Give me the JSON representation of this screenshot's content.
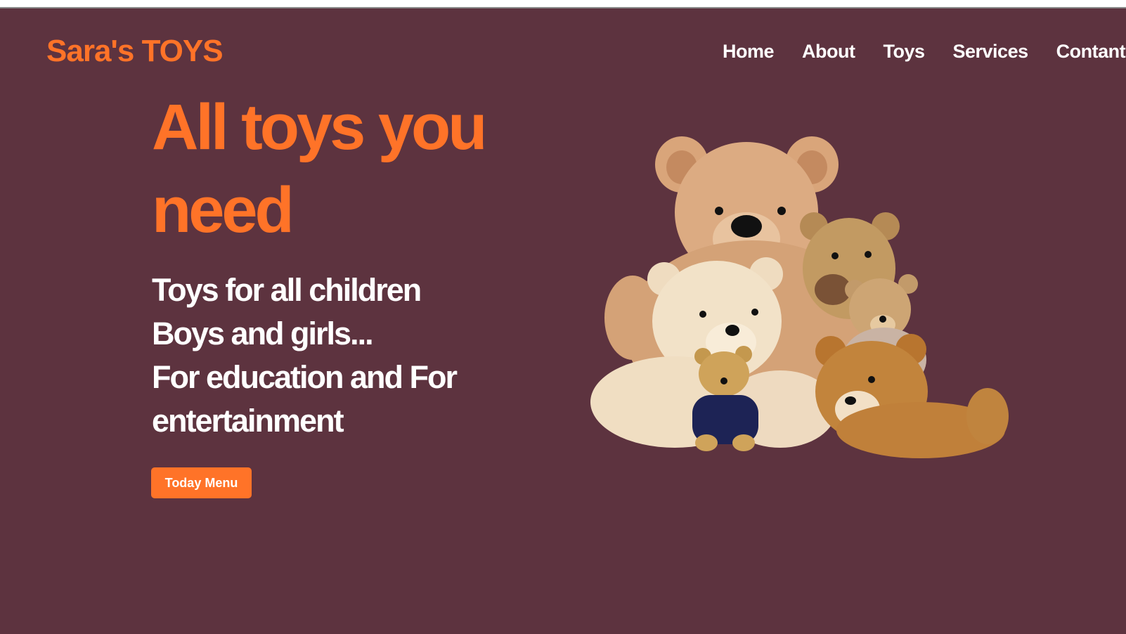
{
  "brand": {
    "name": "Sara's TOYS"
  },
  "nav": [
    {
      "label": "Home"
    },
    {
      "label": "About"
    },
    {
      "label": "Toys"
    },
    {
      "label": "Services"
    },
    {
      "label": "Contant"
    }
  ],
  "hero": {
    "headline": "All toys you need",
    "lines": [
      "Toys for all children",
      "Boys and girls...",
      "For education and For entertainment"
    ],
    "cta_label": "Today Menu",
    "image": "teddy-bears-photo"
  },
  "colors": {
    "background": "#5d333f",
    "accent": "#ff7328",
    "text": "#ffffff"
  }
}
